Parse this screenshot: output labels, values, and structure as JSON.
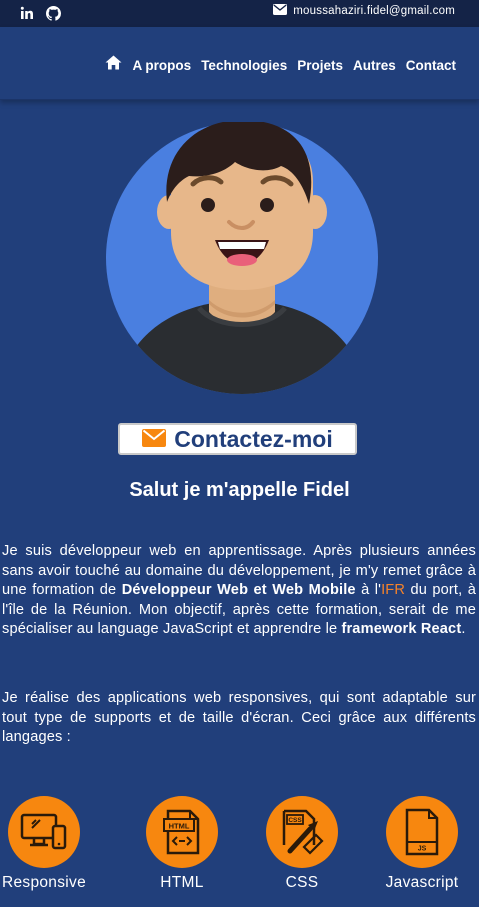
{
  "topbar": {
    "linkedin_icon": "linkedin-icon",
    "github_icon": "github-icon",
    "email": "moussahaziri.fidel@gmail.com"
  },
  "nav": {
    "home_icon": "home-icon",
    "items": [
      {
        "label": "A propos"
      },
      {
        "label": "Technologies"
      },
      {
        "label": "Projets"
      },
      {
        "label": "Autres"
      },
      {
        "label": "Contact"
      }
    ]
  },
  "hero": {
    "contact_button": "Contactez-moi",
    "greeting": "Salut je m'appelle Fidel"
  },
  "about": {
    "p1": {
      "t1": "Je suis développeur web en apprentissage. Après plusieurs années sans avoir touché au domaine du développement, je m'y remet grâce à une formation de ",
      "b1": "Développeur Web et Web Mobile",
      "t2": " à l'",
      "link": "IFR",
      "t3": " du port, à l'île de la Réunion. Mon objectif, après cette formation, serait de me spécialiser au language JavaScript et apprendre le ",
      "b2": "framework React",
      "t4": "."
    },
    "p2": "Je réalise des applications web responsives, qui sont adaptable sur tout type de supports et de taille d'écran. Ceci grâce aux différents langages :"
  },
  "skills": [
    {
      "label": "Responsive",
      "icon": "responsive-devices-icon"
    },
    {
      "label": "HTML",
      "icon": "html-file-icon"
    },
    {
      "label": "CSS",
      "icon": "css-file-icon"
    },
    {
      "label": "Javascript",
      "icon": "js-file-icon"
    }
  ],
  "colors": {
    "background": "#213f7b",
    "topbar": "#142347",
    "accent": "#f7870f",
    "avatar_bg": "#4a7fe0"
  }
}
